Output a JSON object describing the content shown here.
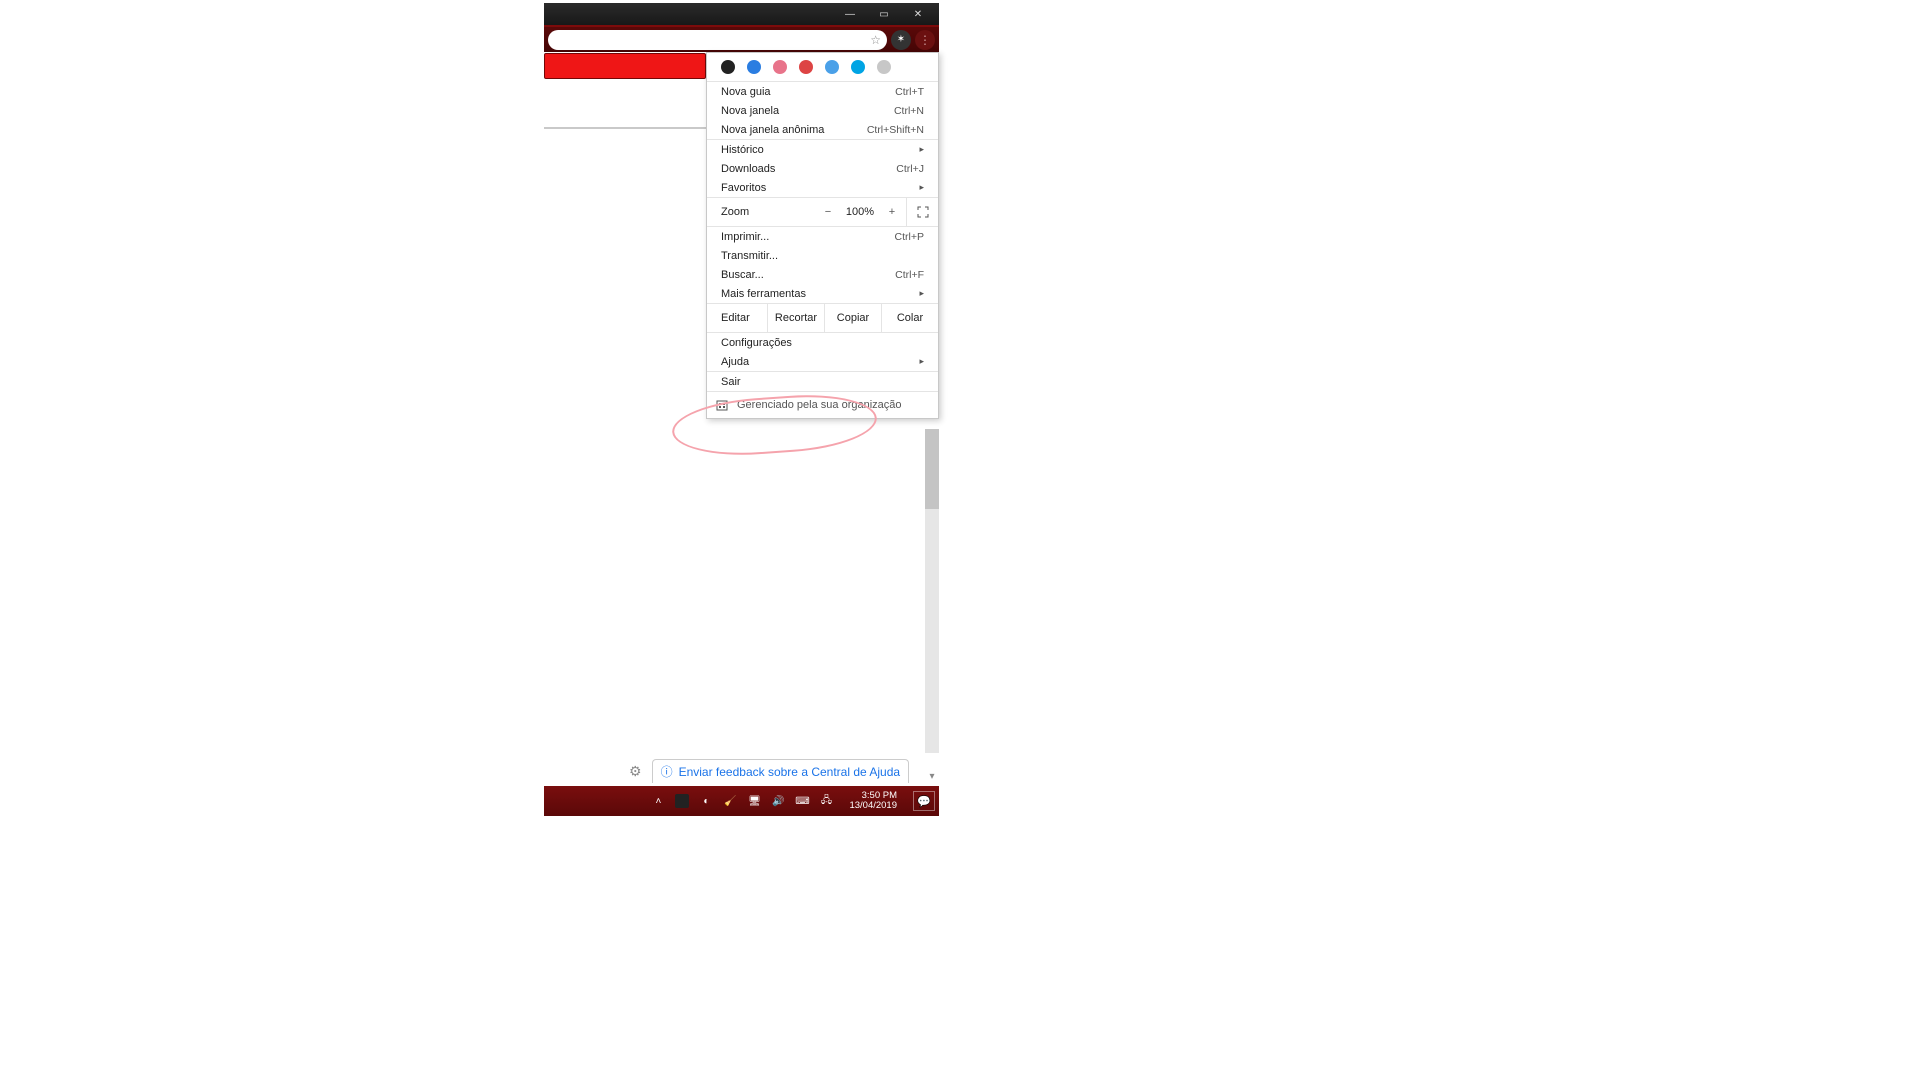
{
  "titlebar": {
    "minimize": "—",
    "maximize": "▭",
    "close": "✕"
  },
  "menu": {
    "new_tab": {
      "label": "Nova guia",
      "shortcut": "Ctrl+T"
    },
    "new_window": {
      "label": "Nova janela",
      "shortcut": "Ctrl+N"
    },
    "incognito": {
      "label": "Nova janela anônima",
      "shortcut": "Ctrl+Shift+N"
    },
    "history": {
      "label": "Histórico"
    },
    "downloads": {
      "label": "Downloads",
      "shortcut": "Ctrl+J"
    },
    "bookmarks": {
      "label": "Favoritos"
    },
    "zoom_label": "Zoom",
    "zoom_minus": "−",
    "zoom_value": "100%",
    "zoom_plus": "+",
    "print": {
      "label": "Imprimir...",
      "shortcut": "Ctrl+P"
    },
    "cast": {
      "label": "Transmitir..."
    },
    "find": {
      "label": "Buscar...",
      "shortcut": "Ctrl+F"
    },
    "more_tools": {
      "label": "Mais ferramentas"
    },
    "edit_label": "Editar",
    "cut": "Recortar",
    "copy": "Copiar",
    "paste": "Colar",
    "settings": {
      "label": "Configurações"
    },
    "help": {
      "label": "Ajuda"
    },
    "exit": {
      "label": "Sair"
    },
    "managed": "Gerenciado pela sua organização"
  },
  "feedback": {
    "label": "Enviar feedback sobre a Central de Ajuda"
  },
  "taskbar": {
    "time": "3:50 PM",
    "date": "13/04/2019"
  }
}
